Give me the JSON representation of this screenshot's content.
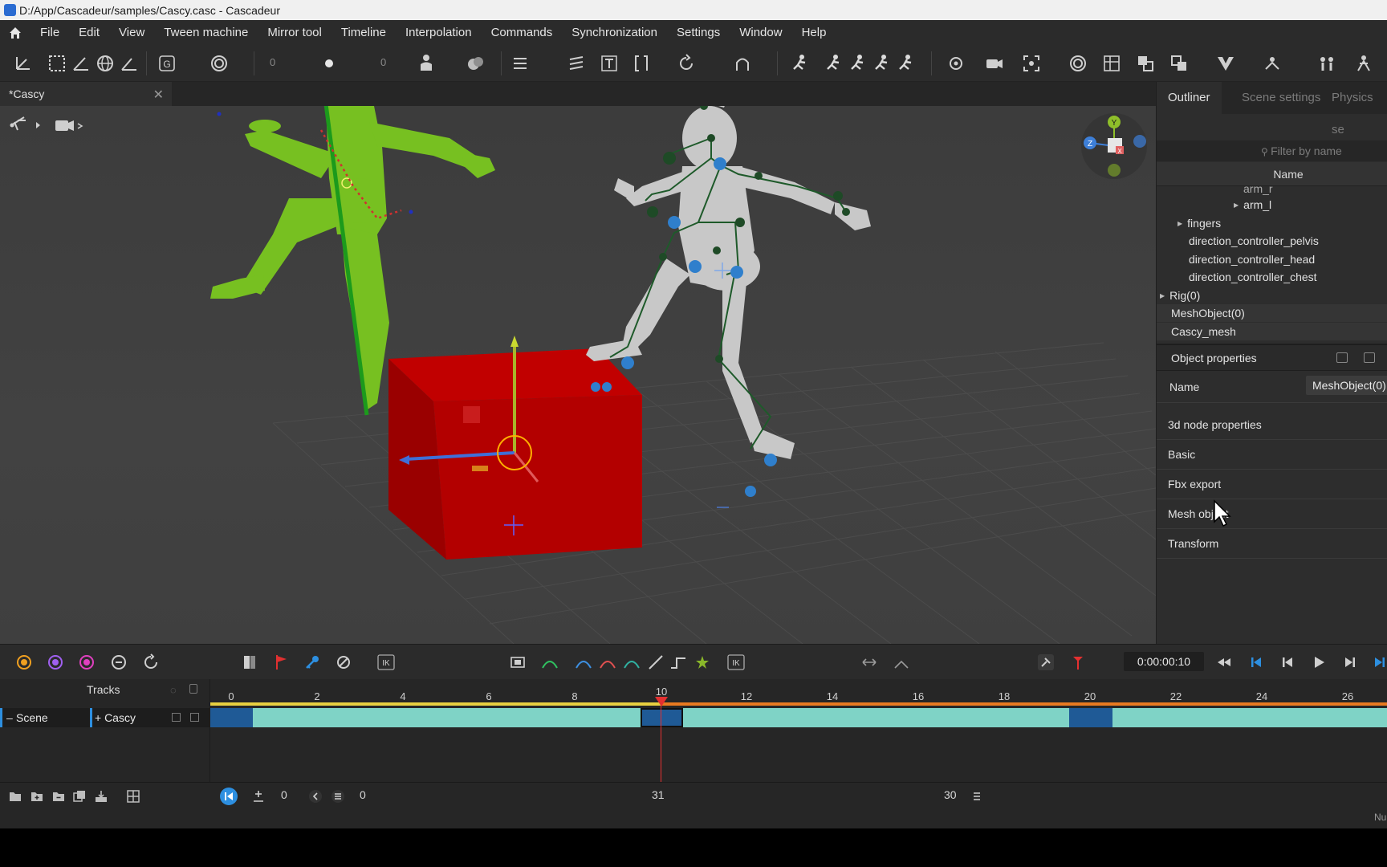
{
  "window": {
    "title": "D:/App/Cascadeur/samples/Cascy.casc - Cascadeur"
  },
  "menu": [
    "File",
    "Edit",
    "View",
    "Tween machine",
    "Mirror tool",
    "Timeline",
    "Interpolation",
    "Commands",
    "Synchronization",
    "Settings",
    "Window",
    "Help"
  ],
  "toolbar": {
    "field1": "0",
    "field2": "0",
    "cube_label_g": "G",
    "cube_label_r": "R"
  },
  "tab": {
    "title": "*Cascy"
  },
  "panel": {
    "tabs": [
      "Outliner",
      "Scene settings",
      "Physics se"
    ],
    "filter_placeholder": "Filter by name",
    "name_header": "Name",
    "outliner_rows": [
      {
        "label": "arm_r",
        "caret": true
      },
      {
        "label": "arm_l",
        "caret": true
      },
      {
        "label": "fingers",
        "caret": true
      },
      {
        "label": "direction_controller_pelvis",
        "caret": false
      },
      {
        "label": "direction_controller_head",
        "caret": false
      },
      {
        "label": "direction_controller_chest",
        "caret": false
      },
      {
        "label": "Rig(0)",
        "caret": true
      },
      {
        "label": "MeshObject(0)",
        "caret": false
      },
      {
        "label": "Cascy_mesh",
        "caret": false
      }
    ],
    "object_properties": "Object properties",
    "name_label": "Name",
    "name_value": "MeshObject(0)",
    "sections": [
      "3d  node  properties",
      "Basic",
      "Fbx export",
      "Mesh object",
      "Transform"
    ]
  },
  "gizmo": {
    "y": "Y",
    "z": "Z",
    "x": "X"
  },
  "timeline": {
    "timecode": "0:00:00:10",
    "tracks_label": "Tracks",
    "scene_label": "Scene",
    "cascy_label": "+ Cascy",
    "ik_label": "IK",
    "ruler": [
      "0",
      "2",
      "4",
      "6",
      "8",
      "10",
      "12",
      "14",
      "16",
      "18",
      "20",
      "22",
      "24",
      "26"
    ],
    "current_frame": 10
  },
  "bottom": {
    "start": "0",
    "range_start": "0",
    "middle": "31",
    "end": "30",
    "corner": "Nu"
  },
  "colors": {
    "accent": "#2d8fe0",
    "keyframe": "#1f5a96",
    "track": "#7fd3c6",
    "playhead": "#e53030"
  }
}
